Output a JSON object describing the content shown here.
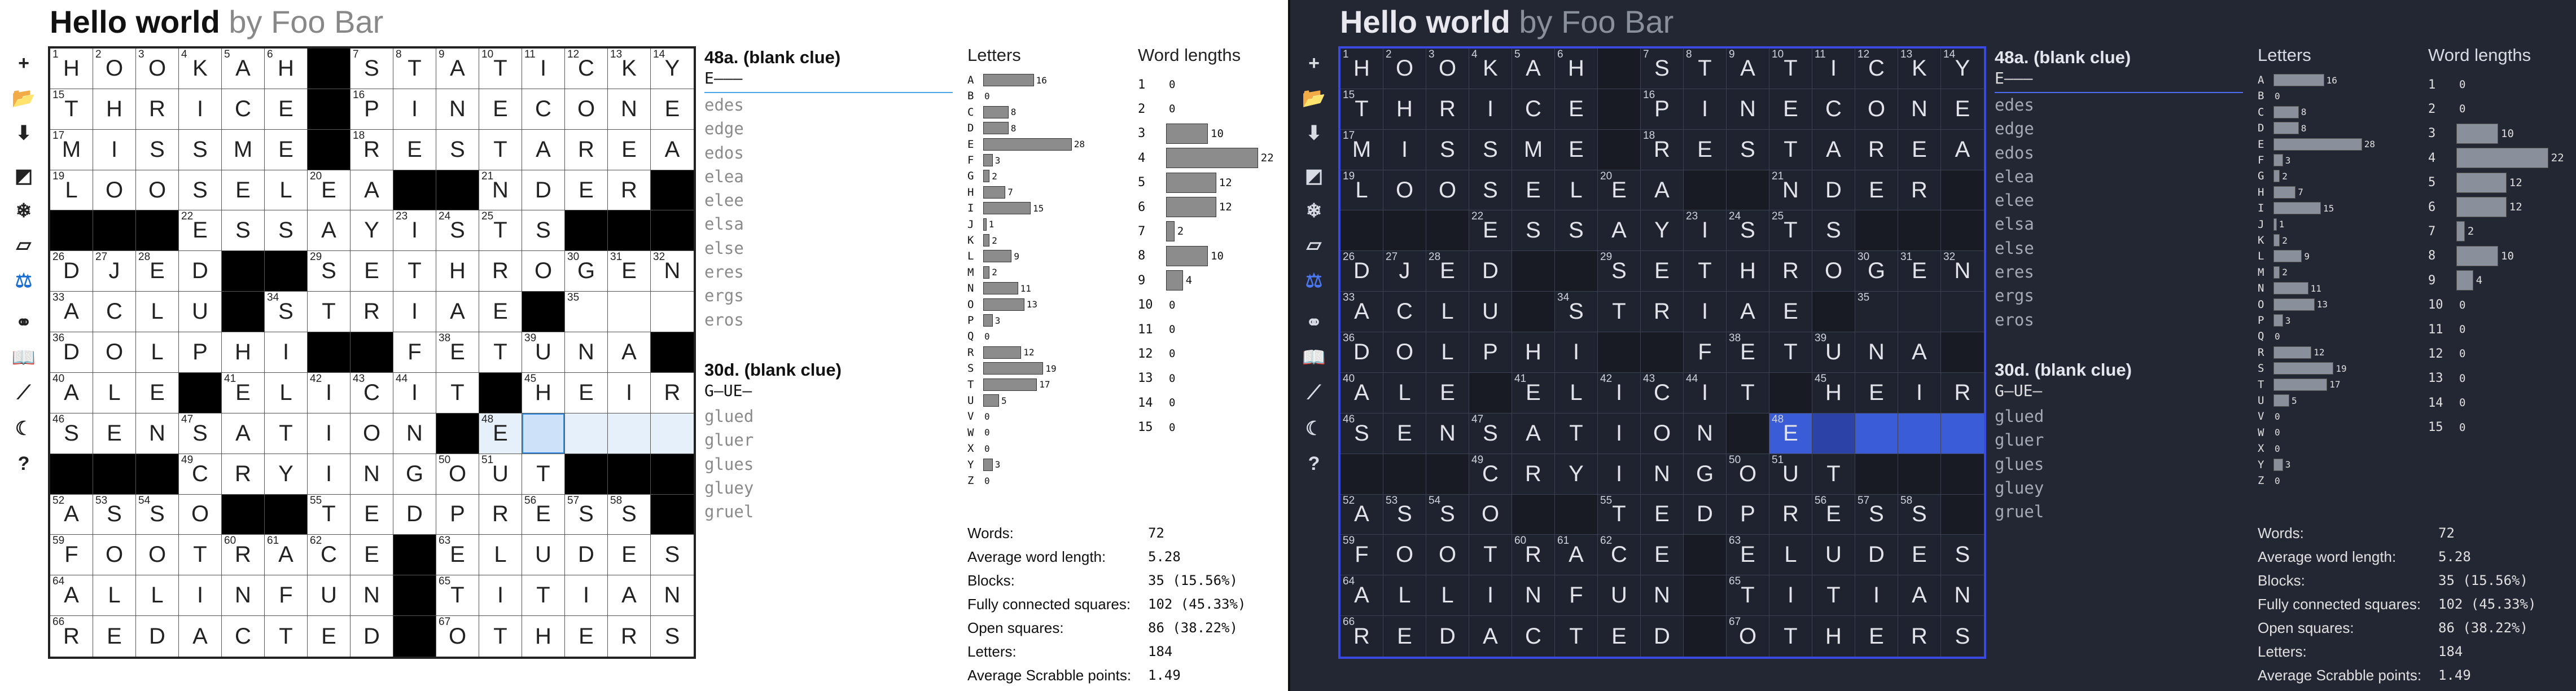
{
  "title": "Hello world",
  "author": "by Foo Bar",
  "toolbar": [
    {
      "name": "add-icon",
      "glyph": "+"
    },
    {
      "name": "open-folder-icon",
      "glyph": "📂"
    },
    {
      "name": "download-icon",
      "glyph": "⬇"
    },
    {
      "name": "symmetry-icon",
      "glyph": "◩"
    },
    {
      "name": "snowflake-icon",
      "glyph": "❄"
    },
    {
      "name": "eraser-icon",
      "glyph": "▱"
    },
    {
      "name": "scale-icon",
      "glyph": "⚖"
    },
    {
      "name": "link-icon",
      "glyph": "⚭"
    },
    {
      "name": "book-icon",
      "glyph": "📖"
    },
    {
      "name": "magic-wand-icon",
      "glyph": "⟋"
    },
    {
      "name": "moon-icon",
      "glyph": "☾"
    },
    {
      "name": "help-icon",
      "glyph": "?"
    }
  ],
  "grid": {
    "rows": [
      "HOOKAH#STATICKY",
      "THRICE#PINECONE",
      "MISSME#RESTAREA",
      "LOOSELEA##NDER#",
      "###ESSAYISTS###",
      "DJED##SETHROGEN",
      "ACLU#STRIAE#___",
      "DOLPHI##FETUNA#",
      "ALE#ELICIT#HEIR",
      "SENSATION#E____",
      "###CRYINGOUT###",
      "ASSO##TEDPRESS#",
      "FOOTRACE#ELUDES",
      "ALLINFUN#TITIAN",
      "REDACTED#OTHERS"
    ],
    "numbers": [
      [
        1,
        2,
        3,
        4,
        5,
        6,
        0,
        7,
        8,
        9,
        10,
        11,
        12,
        13,
        14
      ],
      [
        15,
        0,
        0,
        0,
        0,
        0,
        0,
        16,
        0,
        0,
        0,
        0,
        0,
        0,
        0
      ],
      [
        17,
        0,
        0,
        0,
        0,
        0,
        0,
        18,
        0,
        0,
        0,
        0,
        0,
        0,
        0
      ],
      [
        19,
        0,
        0,
        0,
        0,
        0,
        20,
        0,
        0,
        0,
        21,
        0,
        0,
        0,
        0
      ],
      [
        0,
        0,
        0,
        22,
        0,
        0,
        0,
        0,
        23,
        24,
        25,
        0,
        0,
        0,
        0
      ],
      [
        26,
        27,
        28,
        0,
        0,
        0,
        29,
        0,
        0,
        0,
        0,
        0,
        30,
        31,
        32
      ],
      [
        33,
        0,
        0,
        0,
        0,
        34,
        0,
        0,
        0,
        0,
        0,
        0,
        35,
        0,
        0
      ],
      [
        36,
        0,
        0,
        0,
        0,
        0,
        37,
        0,
        0,
        38,
        0,
        39,
        0,
        0,
        0
      ],
      [
        40,
        0,
        0,
        0,
        41,
        0,
        42,
        43,
        44,
        0,
        0,
        45,
        0,
        0,
        0
      ],
      [
        46,
        0,
        0,
        47,
        0,
        0,
        0,
        0,
        0,
        0,
        48,
        0,
        0,
        0,
        0
      ],
      [
        0,
        0,
        0,
        49,
        0,
        0,
        0,
        0,
        0,
        50,
        51,
        0,
        0,
        0,
        0
      ],
      [
        52,
        53,
        54,
        0,
        0,
        0,
        55,
        0,
        0,
        0,
        0,
        56,
        57,
        58,
        0
      ],
      [
        59,
        0,
        0,
        0,
        60,
        61,
        62,
        0,
        0,
        63,
        0,
        0,
        0,
        0,
        0
      ],
      [
        64,
        0,
        0,
        0,
        0,
        0,
        0,
        0,
        0,
        65,
        0,
        0,
        0,
        0,
        0
      ],
      [
        66,
        0,
        0,
        0,
        0,
        0,
        0,
        0,
        0,
        67,
        0,
        0,
        0,
        0,
        0
      ]
    ]
  },
  "clue1": {
    "title": "48a. (blank clue)",
    "pattern": "E———",
    "suggestions": [
      "edes",
      "edge",
      "edos",
      "elea",
      "elee",
      "elsa",
      "else",
      "eres",
      "ergs",
      "eros"
    ]
  },
  "clue2": {
    "title": "30d. (blank clue)",
    "pattern": "G—UE—",
    "suggestions": [
      "glued",
      "gluer",
      "glues",
      "gluey",
      "gruel"
    ]
  },
  "letters_title": "Letters",
  "letters": [
    {
      "l": "A",
      "c": 16
    },
    {
      "l": "B",
      "c": 0
    },
    {
      "l": "C",
      "c": 8
    },
    {
      "l": "D",
      "c": 8
    },
    {
      "l": "E",
      "c": 28
    },
    {
      "l": "F",
      "c": 3
    },
    {
      "l": "G",
      "c": 2
    },
    {
      "l": "H",
      "c": 7
    },
    {
      "l": "I",
      "c": 15
    },
    {
      "l": "J",
      "c": 1
    },
    {
      "l": "K",
      "c": 2
    },
    {
      "l": "L",
      "c": 9
    },
    {
      "l": "M",
      "c": 2
    },
    {
      "l": "N",
      "c": 11
    },
    {
      "l": "O",
      "c": 13
    },
    {
      "l": "P",
      "c": 3
    },
    {
      "l": "Q",
      "c": 0
    },
    {
      "l": "R",
      "c": 12
    },
    {
      "l": "S",
      "c": 19
    },
    {
      "l": "T",
      "c": 17
    },
    {
      "l": "U",
      "c": 5
    },
    {
      "l": "V",
      "c": 0
    },
    {
      "l": "W",
      "c": 0
    },
    {
      "l": "X",
      "c": 0
    },
    {
      "l": "Y",
      "c": 3
    },
    {
      "l": "Z",
      "c": 0
    }
  ],
  "wordlen_title": "Word lengths",
  "wordlens": [
    {
      "l": "1",
      "c": 0
    },
    {
      "l": "2",
      "c": 0
    },
    {
      "l": "3",
      "c": 10
    },
    {
      "l": "4",
      "c": 22
    },
    {
      "l": "5",
      "c": 12
    },
    {
      "l": "6",
      "c": 12
    },
    {
      "l": "7",
      "c": 2
    },
    {
      "l": "8",
      "c": 10
    },
    {
      "l": "9",
      "c": 4
    },
    {
      "l": "10",
      "c": 0
    },
    {
      "l": "11",
      "c": 0
    },
    {
      "l": "12",
      "c": 0
    },
    {
      "l": "13",
      "c": 0
    },
    {
      "l": "14",
      "c": 0
    },
    {
      "l": "15",
      "c": 0
    }
  ],
  "stats": [
    {
      "label": "Words:",
      "value": "72"
    },
    {
      "label": "Average word length:",
      "value": "5.28"
    },
    {
      "label": "Blocks:",
      "value": "35 (15.56%)"
    },
    {
      "label": "Fully connected squares:",
      "value": "102 (45.33%)"
    },
    {
      "label": "Open squares:",
      "value": "86 (38.22%)"
    },
    {
      "label": "Letters:",
      "value": "184"
    },
    {
      "label": "Average Scrabble points:",
      "value": "1.49"
    }
  ]
}
